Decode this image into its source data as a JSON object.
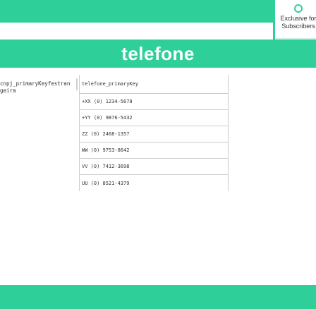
{
  "badge": {
    "line1": "Exclusive for",
    "line2": "Subscribers"
  },
  "page": {
    "title": "telefone"
  },
  "left_column": {
    "label": "cnpj_primaryKeyfestran geira"
  },
  "table": {
    "header": "telefone_primaryKey",
    "rows": [
      "+XX (0) 1234-5678",
      "+YY (0) 9876-5432",
      "ZZ (0) 2468-1357",
      "WW (0) 9753-8642",
      "VV (0) 7412-3698",
      "UU (0) 8521-4379"
    ]
  },
  "colors": {
    "accent": "#2fcf9a"
  }
}
